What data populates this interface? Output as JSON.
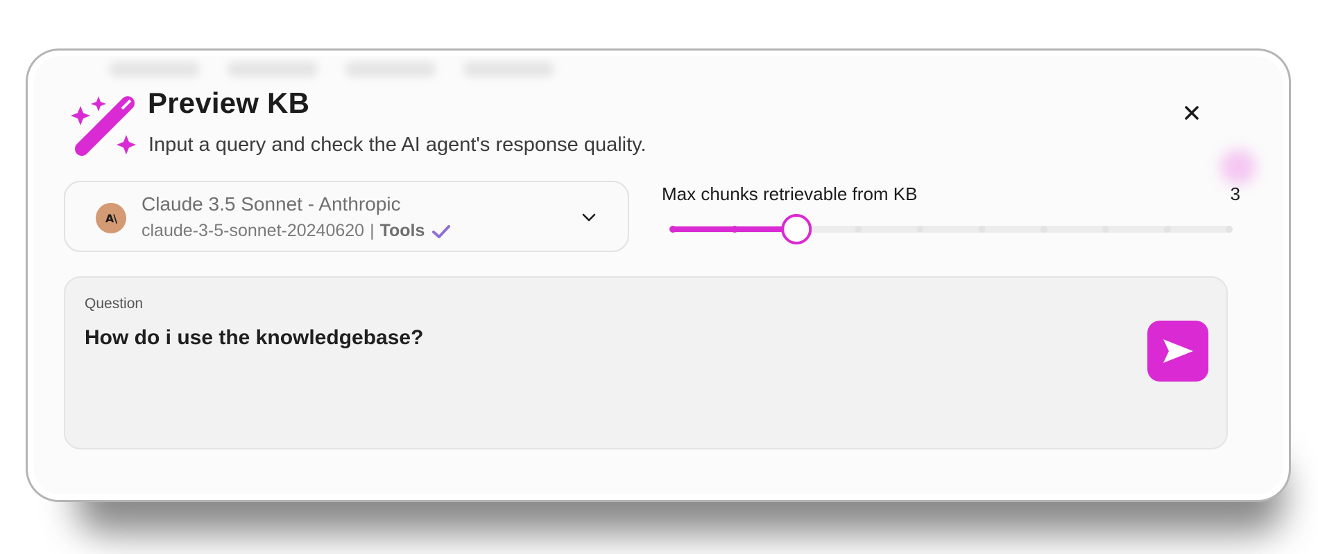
{
  "header": {
    "title": "Preview KB",
    "subtitle": "Input a query and check the AI agent's response quality."
  },
  "model_select": {
    "avatar_text": "A\\",
    "name": "Claude 3.5 Sonnet - Anthropic",
    "model_id": "claude-3-5-sonnet-20240620",
    "separator": "|",
    "capability": "Tools"
  },
  "slider": {
    "label": "Max chunks retrievable from KB",
    "value": "3",
    "min": 1,
    "max": 10,
    "current": 3
  },
  "question": {
    "label": "Question",
    "value": "How do i use the knowledgebase?"
  },
  "colors": {
    "accent": "#d92ad3",
    "check": "#8f6fd6",
    "avatar_bg": "#d39a73"
  },
  "icons": {
    "header": "magic-wand-icon",
    "close": "close-icon",
    "dropdown": "chevron-down-icon",
    "check": "check-icon",
    "send": "send-icon"
  }
}
